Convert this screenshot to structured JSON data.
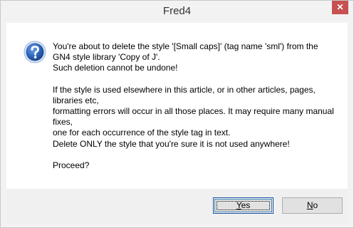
{
  "window": {
    "title": "Fred4",
    "close_glyph": "✕"
  },
  "dialog": {
    "icon": "question-icon",
    "paragraph1": "You're about to delete the style '[Small caps]' (tag name 'sml') from the GN4 style library 'Copy of J'.\nSuch deletion cannot be undone!",
    "paragraph2": "If the style is used elsewhere in this article, or in other articles, pages, libraries etc,\nformatting errors will occur in all those places. It may require many manual fixes,\none for each occurrence of the style tag in text.\nDelete ONLY the style that you're sure it is not used anywhere!",
    "paragraph3": "Proceed?"
  },
  "buttons": {
    "yes": {
      "mnemonic": "Y",
      "rest": "es"
    },
    "no": {
      "mnemonic": "N",
      "rest": "o"
    }
  },
  "colors": {
    "icon_blue": "#2a62b8",
    "close_red": "#c75050",
    "footer_gray": "#f0f0f0"
  }
}
